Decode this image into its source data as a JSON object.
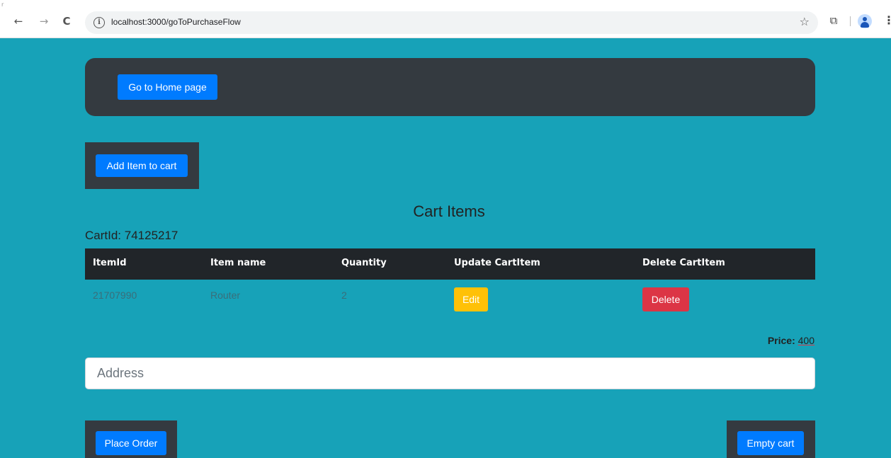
{
  "browser": {
    "url": "localhost:3000/goToPurchaseFlow",
    "back_icon": "←",
    "forward_icon": "→",
    "reload_icon": "C",
    "info_icon": "i",
    "star_icon": "☆",
    "extensions_icon": "⧉",
    "menu_icon": "⋮",
    "corner_mark": "r"
  },
  "header": {
    "home_button": "Go to Home page"
  },
  "actions": {
    "add_item_button": "Add Item to cart"
  },
  "cart": {
    "title": "Cart Items",
    "cart_id_label": "CartId: ",
    "cart_id_value": "74125217",
    "columns": [
      "ItemId",
      "Item name",
      "Quantity",
      "Update CartItem",
      "Delete CartItem"
    ],
    "rows": [
      {
        "item_id": "21707990",
        "item_name": "Router",
        "quantity": "2",
        "edit_label": "Edit",
        "delete_label": "Delete"
      }
    ],
    "price_label": "Price: ",
    "price_value": "400"
  },
  "form": {
    "address_placeholder": "Address",
    "address_value": ""
  },
  "footer": {
    "place_order_button": "Place Order",
    "empty_cart_button": "Empty cart"
  },
  "colors": {
    "page_bg": "#17a2b8",
    "dark_panel": "#343a40",
    "primary": "#007bff",
    "warning": "#ffc107",
    "danger": "#dc3545"
  }
}
